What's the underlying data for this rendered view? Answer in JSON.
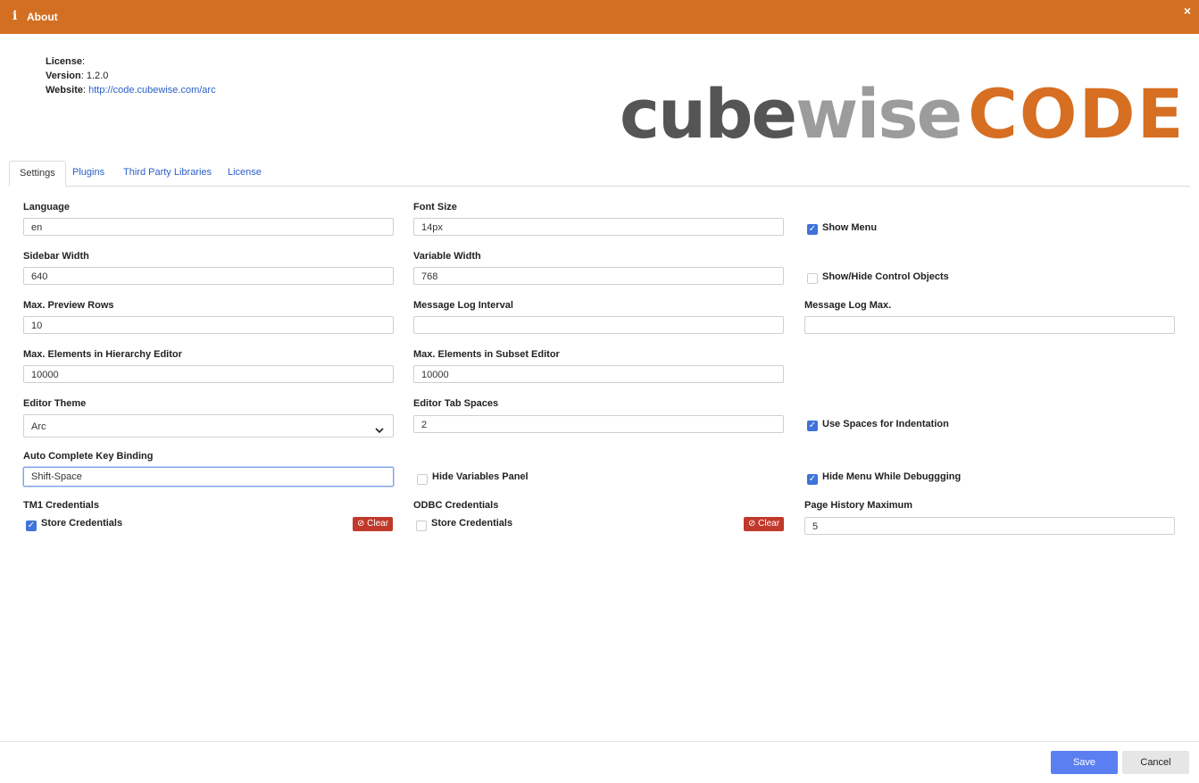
{
  "window": {
    "title": "About",
    "icon": "info-icon",
    "close": "×",
    "accent_color": "#d36f22"
  },
  "info": {
    "license_label": "License",
    "license_value": "",
    "version_label": "Version",
    "version_value": "1.2.0",
    "website_label": "Website",
    "website_value": "http://code.cubewise.com/arc"
  },
  "logo": {
    "part1": "cube",
    "part2": "wise",
    "part3": "CODE"
  },
  "tabs": [
    "Settings",
    "Plugins",
    "Third Party Libraries",
    "License"
  ],
  "fields": {
    "language": {
      "label": "Language",
      "value": "en"
    },
    "font_size": {
      "label": "Font Size",
      "value": "14px"
    },
    "show_menu": {
      "label": "Show Menu",
      "checked": true
    },
    "sidebar_width": {
      "label": "Sidebar Width",
      "value": "640"
    },
    "variable_width": {
      "label": "Variable Width",
      "value": "768"
    },
    "show_hide_control": {
      "label": "Show/Hide Control Objects",
      "checked": false
    },
    "max_preview_rows": {
      "label": "Max. Preview Rows",
      "value": "10"
    },
    "message_log_interval": {
      "label": "Message Log Interval",
      "value": ""
    },
    "message_log_max": {
      "label": "Message Log Max.",
      "value": ""
    },
    "max_hierarchy": {
      "label": "Max. Elements in Hierarchy Editor",
      "value": "10000"
    },
    "max_subset": {
      "label": "Max. Elements in Subset Editor",
      "value": "10000"
    },
    "editor_theme": {
      "label": "Editor Theme",
      "value": "Arc"
    },
    "editor_tab_spaces": {
      "label": "Editor Tab Spaces",
      "value": "2"
    },
    "use_spaces": {
      "label": "Use Spaces for Indentation",
      "checked": true
    },
    "auto_complete": {
      "label": "Auto Complete Key Binding",
      "value": "Shift-Space"
    },
    "hide_variables": {
      "label": "Hide Variables Panel",
      "checked": false
    },
    "hide_menu_debug": {
      "label": "Hide Menu While Debuggging",
      "checked": true
    },
    "tm1_credentials": {
      "label": "TM1 Credentials",
      "store_label": "Store Credentials",
      "checked": true,
      "clear_label": "Clear"
    },
    "odbc_credentials": {
      "label": "ODBC Credentials",
      "store_label": "Store Credentials",
      "checked": false,
      "clear_label": "Clear"
    },
    "page_history_max": {
      "label": "Page History Maximum",
      "value": "5"
    }
  },
  "buttons": {
    "save": "Save",
    "cancel": "Cancel"
  }
}
